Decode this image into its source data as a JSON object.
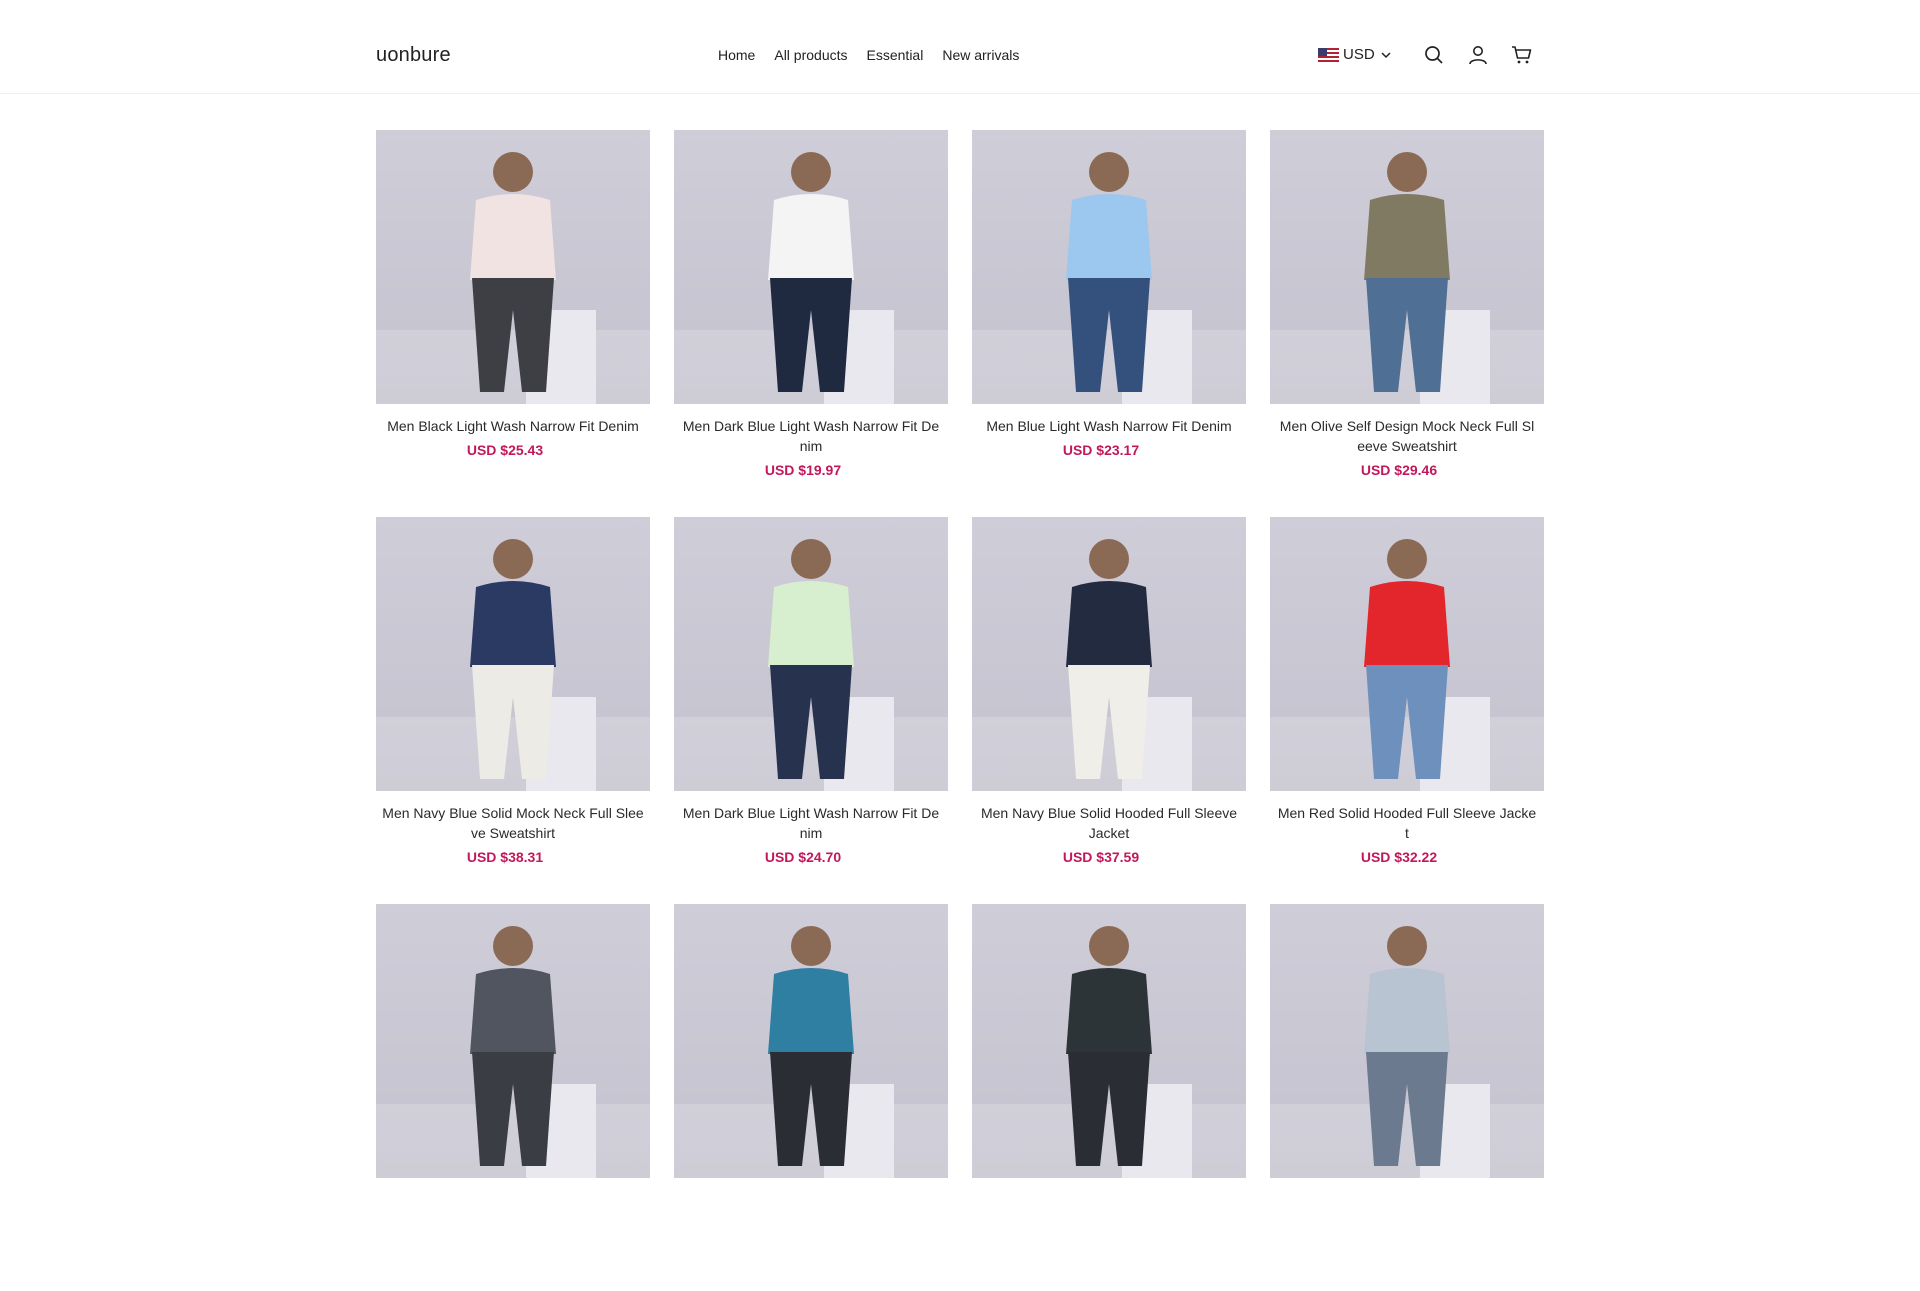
{
  "header": {
    "logo": "uonbure",
    "nav": [
      "Home",
      "All products",
      "Essential",
      "New arrivals"
    ],
    "currency": "USD"
  },
  "colors": {
    "price": "#c2185b",
    "image_bg": "#c9c7d3"
  },
  "products": [
    {
      "name": "Men Black Light Wash Narrow Fit Denim",
      "price": "USD $25.43",
      "top": "#f1e3e1",
      "bottom": "#3d3f44"
    },
    {
      "name": "Men Dark Blue Light Wash Narrow Fit Denim",
      "price": "USD $19.97",
      "top": "#f4f4f4",
      "bottom": "#1f2940"
    },
    {
      "name": "Men Blue Light Wash Narrow Fit Denim",
      "price": "USD $23.17",
      "top": "#9cc7ee",
      "bottom": "#34517e"
    },
    {
      "name": "Men Olive Self Design Mock Neck Full Sleeve Sweatshirt",
      "price": "USD $29.46",
      "top": "#817a63",
      "bottom": "#4f6f95"
    },
    {
      "name": "Men Navy Blue Solid Mock Neck Full Sleeve Sweatshirt",
      "price": "USD $38.31",
      "top": "#2b3a63",
      "bottom": "#ecebe6"
    },
    {
      "name": "Men Dark Blue Light Wash Narrow Fit Denim",
      "price": "USD $24.70",
      "top": "#d7efcf",
      "bottom": "#27324e"
    },
    {
      "name": "Men Navy Blue Solid Hooded Full Sleeve Jacket",
      "price": "USD $37.59",
      "top": "#232b40",
      "bottom": "#efeee9"
    },
    {
      "name": "Men Red Solid Hooded Full Sleeve Jacket",
      "price": "USD $32.22",
      "top": "#e2262b",
      "bottom": "#6e90bd"
    },
    {
      "name": "",
      "price": "",
      "top": "#515560",
      "bottom": "#3a3d44"
    },
    {
      "name": "",
      "price": "",
      "top": "#2f7fa3",
      "bottom": "#2a2d33"
    },
    {
      "name": "",
      "price": "",
      "top": "#2d3438",
      "bottom": "#2a2d33"
    },
    {
      "name": "",
      "price": "",
      "top": "#b9c4d2",
      "bottom": "#6b7a8f"
    }
  ]
}
